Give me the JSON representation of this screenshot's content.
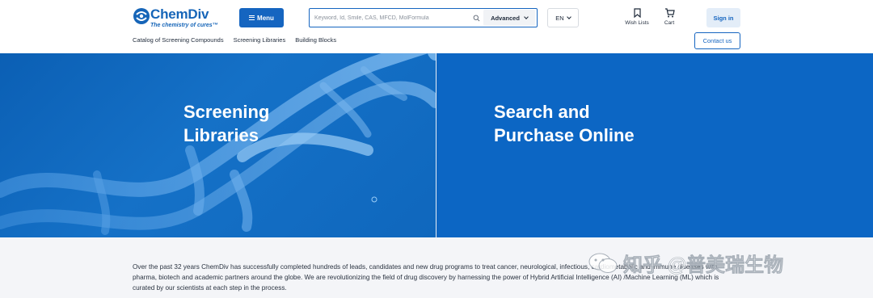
{
  "brand": {
    "name": "ChemDiv",
    "tagline": "The chemistry of cures™",
    "accent": "#1565c0"
  },
  "header": {
    "menu_label": "Menu",
    "search": {
      "placeholder": "Keyword, Id, Smile, CAS, MFCD, MolFormula",
      "value": ""
    },
    "advanced_label": "Advanced",
    "language": "EN",
    "wish_label": "Wish Lists",
    "cart_label": "Cart",
    "signin_label": "Sign in",
    "contact_label": "Contact us"
  },
  "subnav": [
    "Catalog of Screening Compounds",
    "Screening Libraries",
    "Building Blocks"
  ],
  "hero": {
    "left_title_line1": "Screening",
    "left_title_line2": "Libraries",
    "right_title_line1": "Search and",
    "right_title_line2": "Purchase Online"
  },
  "about": {
    "text": "Over the past 32 years ChemDiv has successfully completed hundreds of leads, candidates and new drug programs to treat cancer, neurological, infectious, cardiometabolic and immune diseases with pharma, biotech and academic partners around the globe. We are revolutionizing the field of drug discovery by harnessing the power of Hybrid Artificial Intelligence (AI) /Machine Learning (ML) which is curated by our scientists at each step in the process."
  },
  "watermark": {
    "text": "知乎 @普美瑞生物"
  },
  "icons": {
    "logo": "chemdiv-logo-icon",
    "menu": "hamburger-icon",
    "search": "search-icon",
    "chevron": "chevron-down-icon",
    "wish": "bookmark-icon",
    "cart": "cart-icon",
    "hero_image": "dna-helix-image"
  }
}
